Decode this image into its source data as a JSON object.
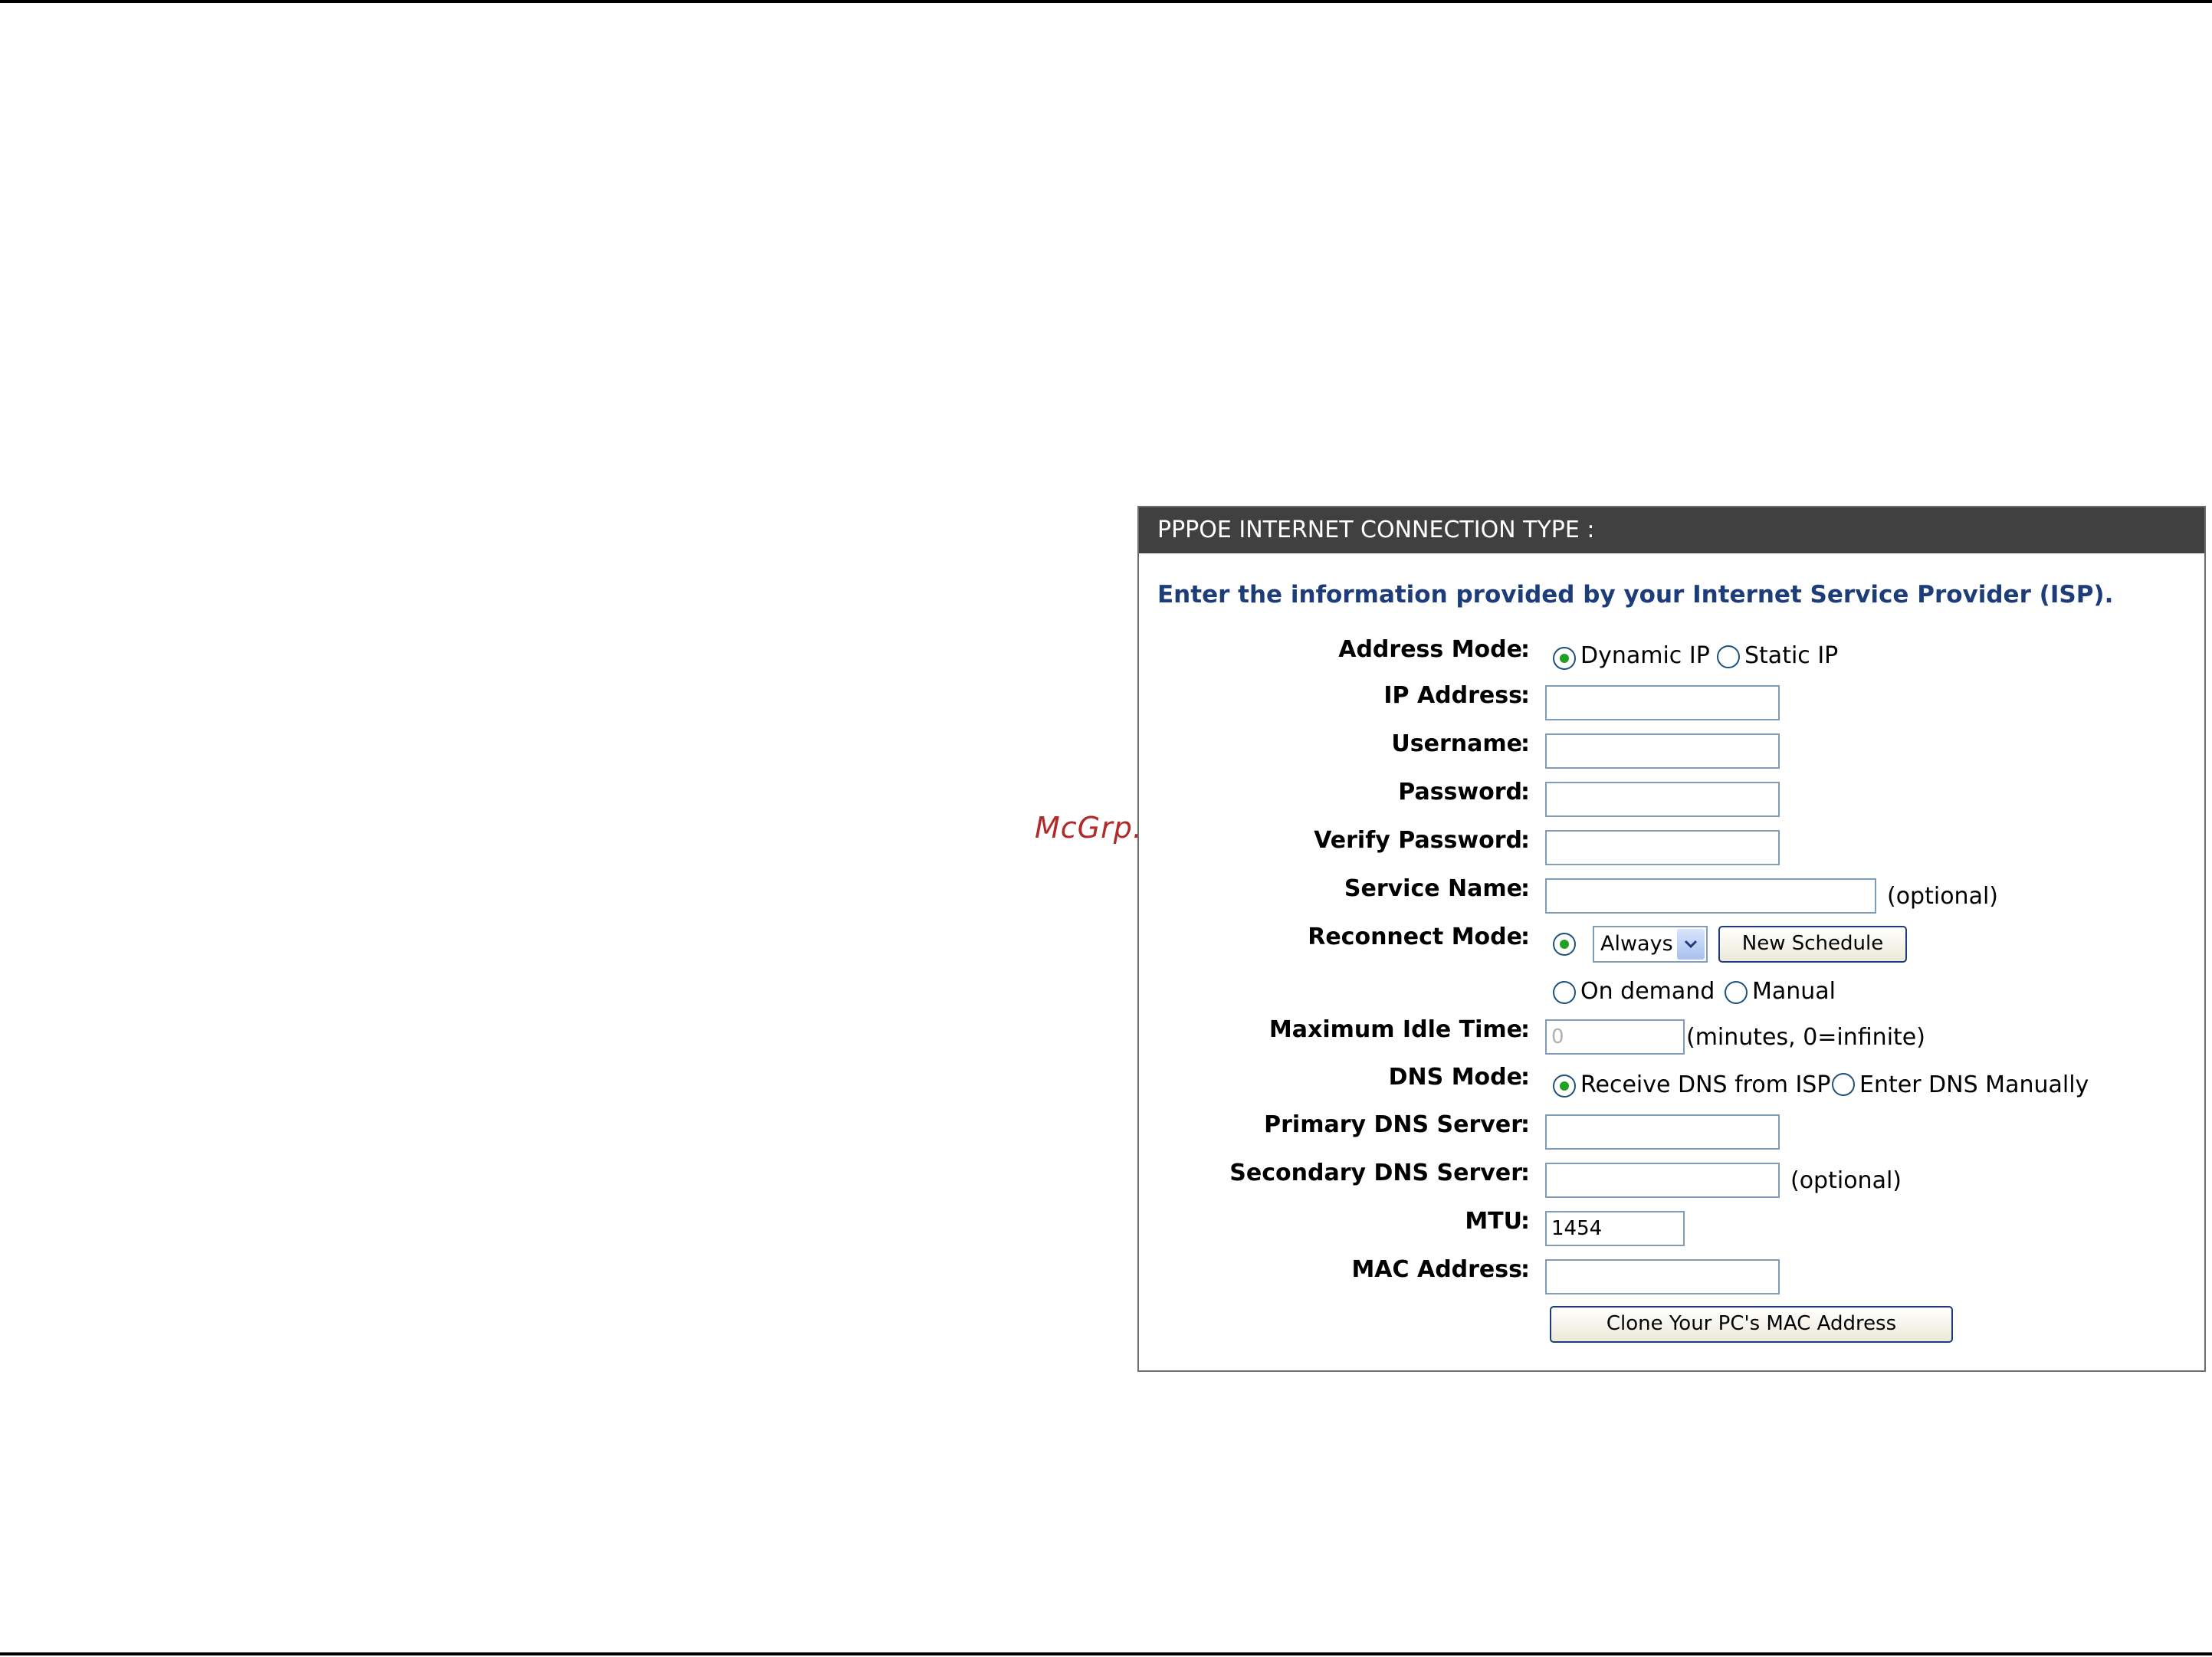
{
  "watermark": "McGrp.Ru",
  "panel": {
    "title": "PPPOE INTERNET CONNECTION TYPE :",
    "intro": "Enter the information provided by your Internet Service Provider (ISP)."
  },
  "colon": ":",
  "address_mode": {
    "label": "Address Mode",
    "options": [
      "Dynamic IP",
      "Static IP"
    ],
    "selected": "Dynamic IP"
  },
  "ip_address": {
    "label": "IP Address",
    "value": ""
  },
  "username": {
    "label": "Username",
    "value": ""
  },
  "password": {
    "label": "Password",
    "value": ""
  },
  "verify_password": {
    "label": "Verify Password",
    "value": ""
  },
  "service_name": {
    "label": "Service Name",
    "value": "",
    "note": "(optional)"
  },
  "reconnect_mode": {
    "label": "Reconnect Mode",
    "schedule_value": "Always",
    "new_schedule_button": "New Schedule",
    "options": [
      "On demand",
      "Manual"
    ],
    "selected": "schedule"
  },
  "max_idle_time": {
    "label": "Maximum Idle Time",
    "value": "0",
    "note": "(minutes, 0=infinite)"
  },
  "dns_mode": {
    "label": "DNS Mode",
    "options": [
      "Receive DNS from ISP",
      "Enter DNS Manually"
    ],
    "selected": "Receive DNS from ISP"
  },
  "primary_dns": {
    "label": "Primary DNS Server",
    "value": ""
  },
  "secondary_dns": {
    "label": "Secondary DNS Server",
    "value": "",
    "note": "(optional)"
  },
  "mtu": {
    "label": "MTU",
    "value": "1454"
  },
  "mac_address": {
    "label": "MAC Address",
    "value": "",
    "clone_button": "Clone Your PC's MAC Address"
  },
  "colors": {
    "header_bg": "#404040",
    "intro_text": "#1c3d7a",
    "radio_dot": "#21a121",
    "watermark": "#b02a2a"
  }
}
